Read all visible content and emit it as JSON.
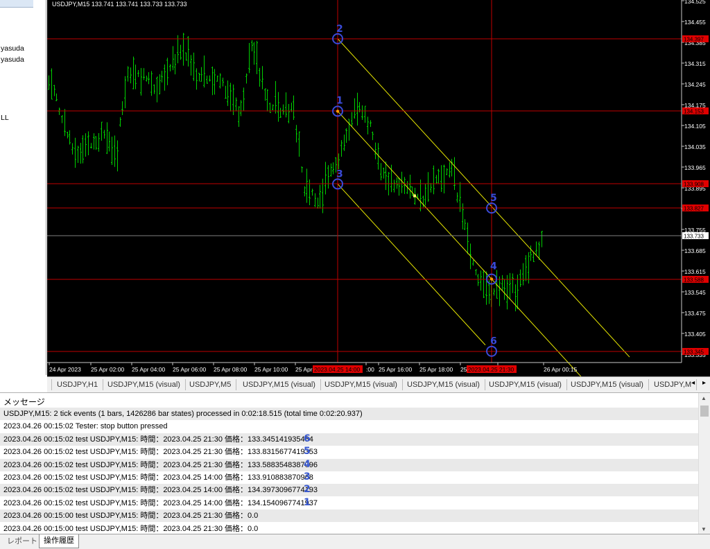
{
  "left_panel": {
    "items": [
      "yasuda",
      "yasuda",
      "LL"
    ]
  },
  "chart": {
    "header": "USDJPY,M15  133.741 133.741 133.733 133.733",
    "price_ticks": [
      "134.525",
      "134.455",
      "134.385",
      "134.315",
      "134.245",
      "134.175",
      "134.105",
      "134.035",
      "133.965",
      "133.895",
      "133.825",
      "133.755",
      "133.685",
      "133.615",
      "133.545",
      "133.475",
      "133.405",
      "133.335"
    ],
    "hline_labels": [
      {
        "text": "134.397",
        "color": "#e00000"
      },
      {
        "text": "134.153",
        "color": "#e00000"
      },
      {
        "text": "133.908",
        "color": "#e00000"
      },
      {
        "text": "133.827",
        "color": "#e00000"
      },
      {
        "text": "133.733",
        "color": "#ffffff"
      },
      {
        "text": "133.588",
        "color": "#e00000"
      },
      {
        "text": "133.345",
        "color": "#e00000"
      }
    ],
    "time_labels": [
      "24 Apr 2023",
      "25 Apr 02:00",
      "25 Apr 04:00",
      "25 Apr 06:00",
      "25 Apr 08:00",
      "25 Apr 10:00",
      "25 Apr 12:00",
      ":00",
      "25 Apr 16:00",
      "25 Apr 18:00",
      "25",
      "r 22:00",
      "26 Apr 00:15"
    ],
    "vline_labels": [
      "2023.04.25 14:00",
      "2023.04.25 21:30"
    ],
    "markers": [
      "1",
      "2",
      "3",
      "4",
      "5",
      "6"
    ],
    "colors": {
      "background": "#000000",
      "candles": "#00d000",
      "channel": "#e6e600",
      "hline": "#c00000",
      "marker": "#3a4ad8",
      "current_price_line": "#808080"
    }
  },
  "symbol_tabs": [
    "USDJPY,H1",
    "USDJPY,M15 (visual)",
    "USDJPY,M5",
    "USDJPY,M15 (visual)",
    "USDJPY,M15 (visual)",
    "USDJPY,M15 (visual)",
    "USDJPY,M15 (visual)",
    "USDJPY,M15 (visual)",
    "USDJPY,M"
  ],
  "symbol_tabs_scroll": "◂ ▸",
  "messages": {
    "header": "メッセージ",
    "rows": [
      {
        "text": "USDJPY,M15: 2 tick events (1 bars, 1426286 bar states) processed in 0:02:18.515 (total time 0:02:20.937)",
        "ann": ""
      },
      {
        "text": "2023.04.26 00:15:02  Tester: stop button pressed",
        "ann": ""
      },
      {
        "text": "2023.04.26 00:15:02  test USDJPY,M15: 時間：2023.04.25 21:30 価格：133.345141935484",
        "ann": "6"
      },
      {
        "text": "2023.04.26 00:15:02  test USDJPY,M15: 時間：2023.04.25 21:30 価格：133.8315677419353",
        "ann": "5"
      },
      {
        "text": "2023.04.26 00:15:02  test USDJPY,M15: 時間：2023.04.25 21:30 価格：133.5883548387096",
        "ann": "4"
      },
      {
        "text": "2023.04.26 00:15:02  test USDJPY,M15: 時間：2023.04.25 14:00 価格：133.910883870968",
        "ann": "3"
      },
      {
        "text": "2023.04.26 00:15:02  test USDJPY,M15: 時間：2023.04.25 14:00 価格：134.3973096774193",
        "ann": "2"
      },
      {
        "text": "2023.04.26 00:15:02  test USDJPY,M15: 時間：2023.04.25 14:00 価格：134.1540967741937",
        "ann": "1"
      },
      {
        "text": "2023.04.26 00:15:00  test USDJPY,M15: 時間：2023.04.25 21:30 価格：0.0",
        "ann": ""
      },
      {
        "text": "2023.04.26 00:15:00  test USDJPY,M15: 時間：2023.04.25 21:30 価格：0.0",
        "ann": ""
      }
    ]
  },
  "bottom_tabs": [
    "レポート",
    "操作履歴"
  ]
}
